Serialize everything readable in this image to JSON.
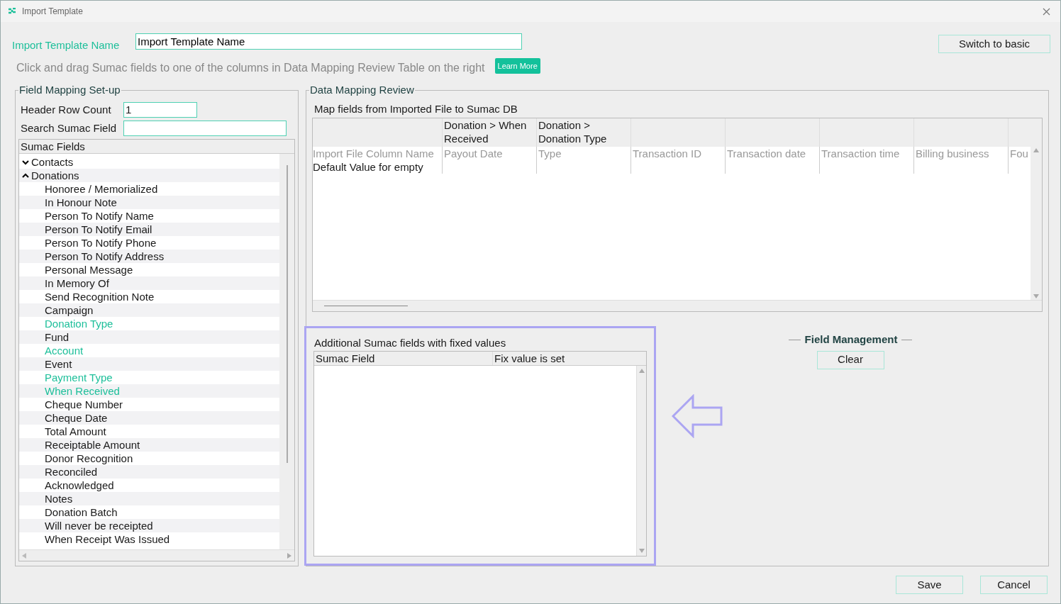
{
  "window": {
    "title": "Import Template"
  },
  "template_name": {
    "label": "Import Template Name",
    "value": "Import Template Name"
  },
  "switch_button": "Switch to basic",
  "instruction": "Click and drag Sumac fields to one of the columns in Data Mapping Review Table on the right",
  "learn_more": "Learn More",
  "field_setup": {
    "title": "Field Mapping Set-up",
    "header_row_count": {
      "label": "Header Row Count",
      "value": "1"
    },
    "search": {
      "label": "Search Sumac Field"
    },
    "tree_title": "Sumac Fields",
    "tree": [
      {
        "label": "Contacts",
        "expanded": false
      },
      {
        "label": "Donations",
        "expanded": true,
        "children": [
          {
            "label": "Honoree / Memorialized",
            "mapped": false
          },
          {
            "label": "In Honour Note",
            "mapped": false
          },
          {
            "label": "Person To Notify Name",
            "mapped": false
          },
          {
            "label": "Person To Notify Email",
            "mapped": false
          },
          {
            "label": "Person To Notify Phone",
            "mapped": false
          },
          {
            "label": "Person To Notify Address",
            "mapped": false
          },
          {
            "label": "Personal Message",
            "mapped": false
          },
          {
            "label": "In Memory Of",
            "mapped": false
          },
          {
            "label": "Send Recognition Note",
            "mapped": false
          },
          {
            "label": "Campaign",
            "mapped": false
          },
          {
            "label": "Donation Type",
            "mapped": true
          },
          {
            "label": "Fund",
            "mapped": false
          },
          {
            "label": "Account",
            "mapped": true
          },
          {
            "label": "Event",
            "mapped": false
          },
          {
            "label": "Payment Type",
            "mapped": true
          },
          {
            "label": "When Received",
            "mapped": true
          },
          {
            "label": "Cheque Number",
            "mapped": false
          },
          {
            "label": "Cheque Date",
            "mapped": false
          },
          {
            "label": "Total Amount",
            "mapped": false
          },
          {
            "label": "Receiptable Amount",
            "mapped": false
          },
          {
            "label": "Donor Recognition",
            "mapped": false
          },
          {
            "label": "Reconciled",
            "mapped": false
          },
          {
            "label": "Acknowledged",
            "mapped": false
          },
          {
            "label": "Notes",
            "mapped": false
          },
          {
            "label": "Donation Batch",
            "mapped": false
          },
          {
            "label": "Will never be receipted",
            "mapped": false
          },
          {
            "label": "When Receipt Was Issued",
            "mapped": false
          }
        ]
      }
    ]
  },
  "review": {
    "title": "Data Mapping Review",
    "subtitle": "Map fields from Imported File to Sumac DB",
    "row_labels": {
      "source": "Import File Column Name",
      "default": "Default Value for empty"
    },
    "columns": [
      {
        "mapping": "Donation > When Received",
        "source": "Payout Date"
      },
      {
        "mapping": "Donation > Donation Type",
        "source": "Type"
      },
      {
        "source": "Transaction ID"
      },
      {
        "source": "Transaction date"
      },
      {
        "source": "Transaction time"
      },
      {
        "source": "Billing business"
      },
      {
        "source": "Fou"
      }
    ]
  },
  "fixed_values": {
    "title": "Additional Sumac fields with fixed values",
    "columns": [
      "Sumac Field",
      "Fix value is set"
    ]
  },
  "field_management": {
    "title": "Field Management",
    "button": "Clear"
  },
  "buttons": [
    "Save",
    "Cancel"
  ]
}
